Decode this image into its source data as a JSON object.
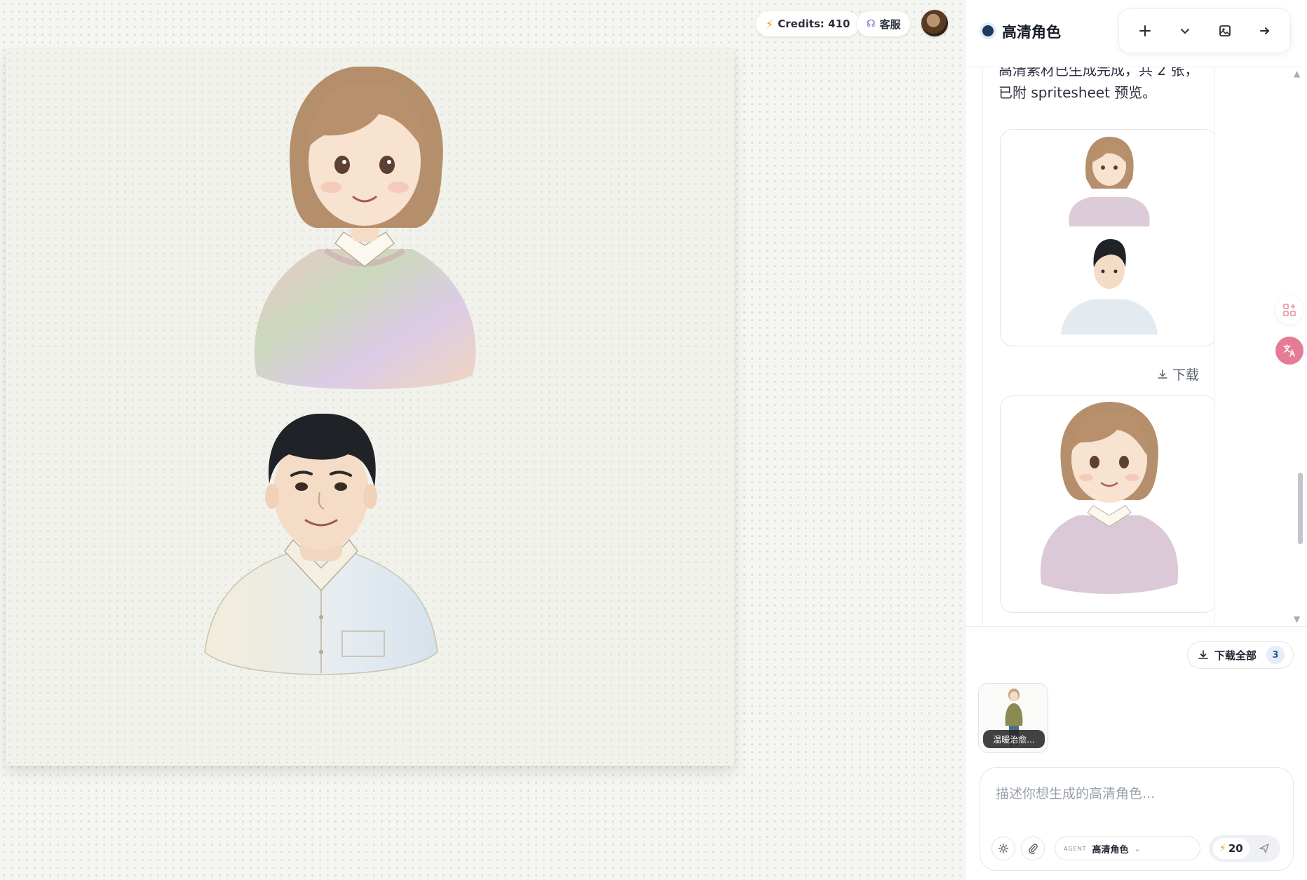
{
  "topbar": {
    "credits_label": "Credits: 410",
    "support_label": "客服"
  },
  "panel": {
    "title": "高清角色",
    "toolbar": {
      "new_icon": "plus-icon",
      "dropdown_icon": "chevron-down-icon",
      "gallery_icon": "image-icon",
      "collapse_icon": "arrow-right-icon"
    }
  },
  "chat": {
    "message_text": "高清素材已生成完成，共 2 张，已附 spritesheet 预览。",
    "download_label": "下载"
  },
  "footer": {
    "download_all_label": "下载全部",
    "download_all_count": "3",
    "attachment_label": "温暖治愈..."
  },
  "composer": {
    "placeholder": "描述你想生成的高清角色...",
    "agent_tag": "AGENT",
    "agent_name": "高清角色",
    "cost": "20"
  },
  "colors": {
    "accent_dot": "#1e3a5f",
    "bolt": "#f0a020",
    "translate_button": "#e57c95",
    "badge_bg": "#e4edf8"
  }
}
